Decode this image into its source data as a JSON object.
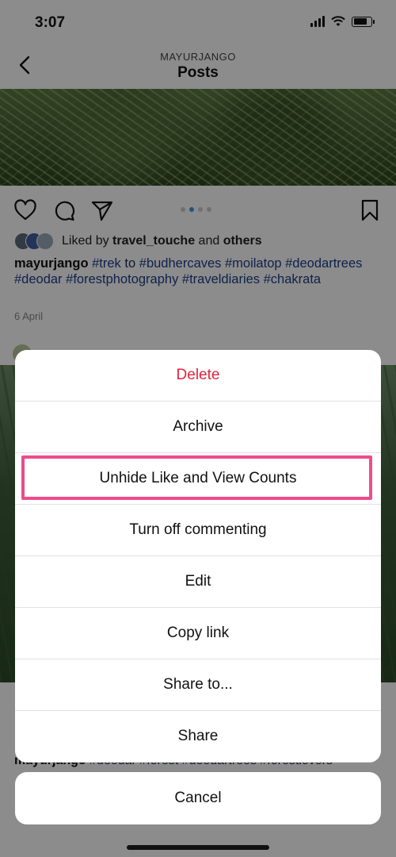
{
  "status_bar": {
    "time": "3:07"
  },
  "header": {
    "username": "MAYURJANGO",
    "title": "Posts"
  },
  "post": {
    "liked_prefix": "Liked by",
    "liked_user": "travel_touche",
    "liked_and": "and",
    "liked_others": "others",
    "caption_user": "mayurjango",
    "caption_text_1": "#trek",
    "caption_to": "to",
    "caption_tags": "#budhercaves #moilatop #deodartrees #deodar #forestphotography #traveldiaries #chakrata",
    "date": "6 April"
  },
  "second_post": {
    "caption_user": "mayurjango",
    "caption_tags": "#deodar #forest #deodartrees #forestlovers"
  },
  "action_sheet": {
    "items": [
      {
        "label": "Delete"
      },
      {
        "label": "Archive"
      },
      {
        "label": "Unhide Like and View Counts"
      },
      {
        "label": "Turn off commenting"
      },
      {
        "label": "Edit"
      },
      {
        "label": "Copy link"
      },
      {
        "label": "Share to..."
      },
      {
        "label": "Share"
      }
    ],
    "cancel_label": "Cancel"
  },
  "colors": {
    "danger": "#e0233b",
    "highlight": "#ee4c8c",
    "accent": "#3897f0"
  },
  "icons": [
    "back-icon",
    "heart-icon",
    "comment-icon",
    "send-icon",
    "bookmark-icon",
    "wifi-icon",
    "battery-icon",
    "signal-icon"
  ]
}
